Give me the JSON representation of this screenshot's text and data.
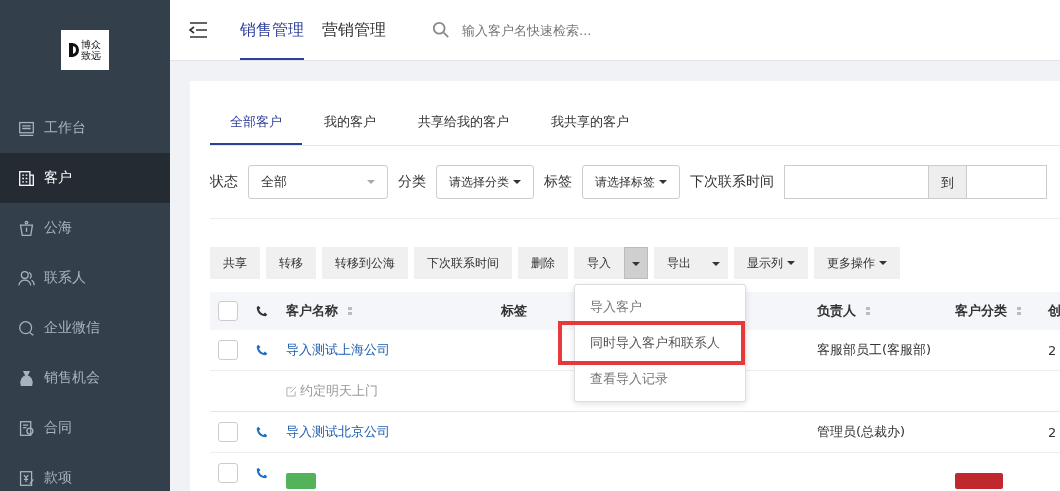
{
  "logo": {
    "line1": "博众",
    "line2": "致远"
  },
  "sidebar": {
    "items": [
      {
        "label": "工作台",
        "selected": false
      },
      {
        "label": "客户",
        "selected": true
      },
      {
        "label": "公海",
        "selected": false
      },
      {
        "label": "联系人",
        "selected": false
      },
      {
        "label": "企业微信",
        "selected": false
      },
      {
        "label": "销售机会",
        "selected": false
      },
      {
        "label": "合同",
        "selected": false
      },
      {
        "label": "款项",
        "selected": false
      }
    ]
  },
  "topbar": {
    "tabs": [
      {
        "label": "销售管理",
        "selected": true
      },
      {
        "label": "营销管理",
        "selected": false
      }
    ],
    "search": {
      "placeholder": "输入客户名快速检索..."
    }
  },
  "customer_tabs": [
    {
      "label": "全部客户",
      "selected": true
    },
    {
      "label": "我的客户",
      "selected": false
    },
    {
      "label": "共享给我的客户",
      "selected": false
    },
    {
      "label": "我共享的客户",
      "selected": false
    }
  ],
  "filters": {
    "status_label": "状态",
    "status_value": "全部",
    "category_label": "分类",
    "category_value": "请选择分类",
    "tag_label": "标签",
    "tag_value": "请选择标签",
    "time_label": "下次联系时间",
    "to": "到"
  },
  "actions": [
    {
      "label": "共享",
      "kind": "plain"
    },
    {
      "label": "转移",
      "kind": "plain"
    },
    {
      "label": "转移到公海",
      "kind": "plain"
    },
    {
      "label": "下次联系时间",
      "kind": "plain"
    },
    {
      "label": "删除",
      "kind": "plain"
    },
    {
      "label": "导入",
      "kind": "split",
      "open": true
    },
    {
      "label": "导出",
      "kind": "split",
      "open": false
    },
    {
      "label": "显示列",
      "kind": "menu"
    },
    {
      "label": "更多操作",
      "kind": "menu"
    }
  ],
  "import_menu": {
    "items": [
      {
        "label": "导入客户",
        "highlighted": false
      },
      {
        "label": "同时导入客户和联系人",
        "highlighted": true
      },
      {
        "label": "查看导入记录",
        "highlighted": false
      }
    ]
  },
  "table": {
    "select_all_checked": false,
    "columns": [
      "客户名称",
      "标签",
      "负责人",
      "客户分类",
      "创"
    ],
    "rows": [
      {
        "checked": false,
        "name": "导入测试上海公司",
        "owner": "客服部员工(客服部)",
        "column_5": "2",
        "note": "约定明天上门"
      },
      {
        "checked": false,
        "name": "导入测试北京公司",
        "owner": "管理员(总裁办)",
        "column_5": "2"
      },
      {
        "checked": false,
        "kind": "tagged"
      }
    ]
  }
}
